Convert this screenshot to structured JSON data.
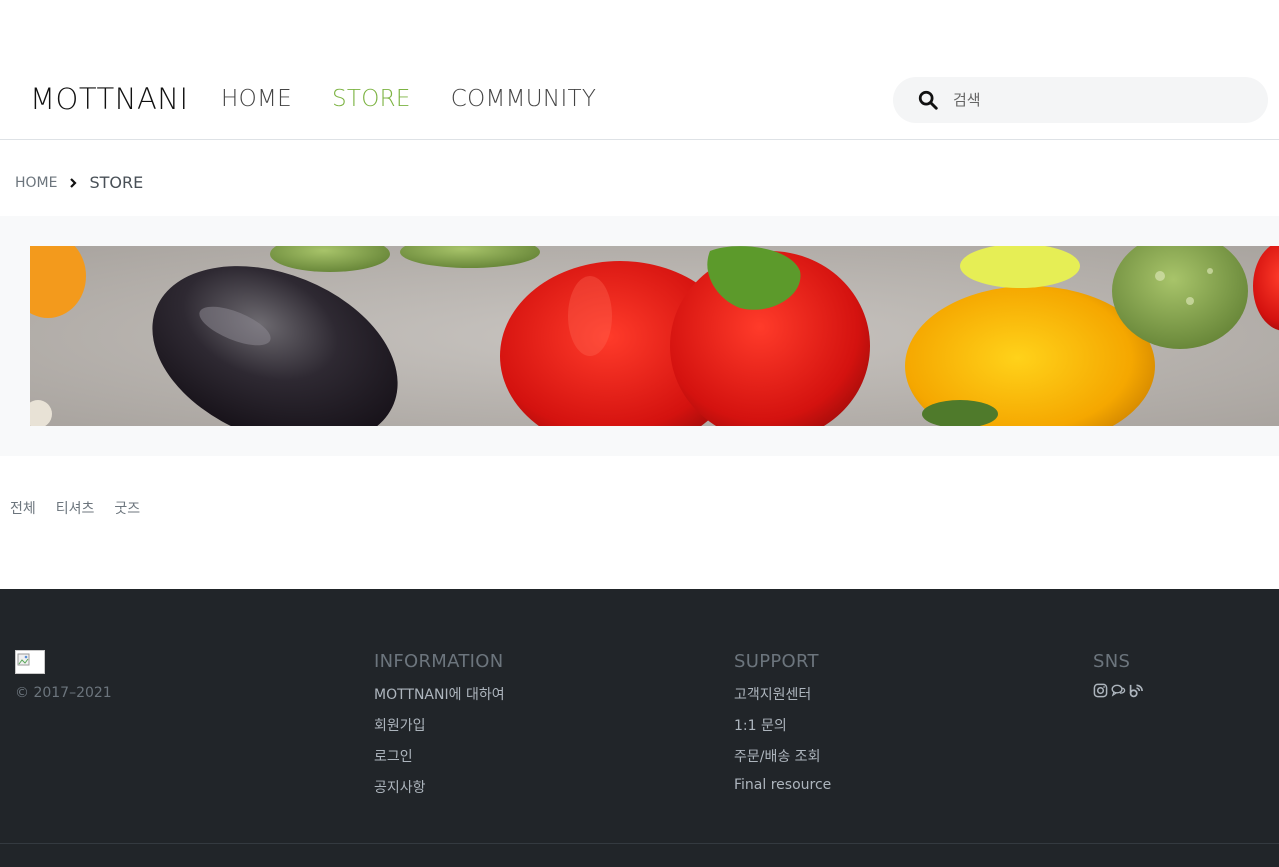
{
  "header": {
    "brand": "MOTTNANI",
    "nav": [
      {
        "label": "HOME"
      },
      {
        "label": "STORE"
      },
      {
        "label": "COMMUNITY"
      }
    ],
    "search": {
      "placeholder": "검색",
      "icon": "search-icon"
    }
  },
  "breadcrumb": {
    "home": "HOME",
    "current": "STORE"
  },
  "categories": [
    "전체",
    "티셔츠",
    "굿즈"
  ],
  "footer": {
    "copyright": "© 2017–2021",
    "information": {
      "title": "INFORMATION",
      "links": [
        "MOTTNANI에 대하여",
        "회원가입",
        "로그인",
        "공지사항"
      ]
    },
    "support": {
      "title": "SUPPORT",
      "links": [
        "고객지원센터",
        "1:1 문의",
        "주문/배송 조회",
        "Final resource"
      ]
    },
    "sns": {
      "title": "SNS",
      "icons": [
        "instagram-icon",
        "chat-icon",
        "blog-icon"
      ]
    }
  },
  "colors": {
    "accent": "#7cb342",
    "footer_bg": "#212529",
    "muted": "#6c757d"
  }
}
